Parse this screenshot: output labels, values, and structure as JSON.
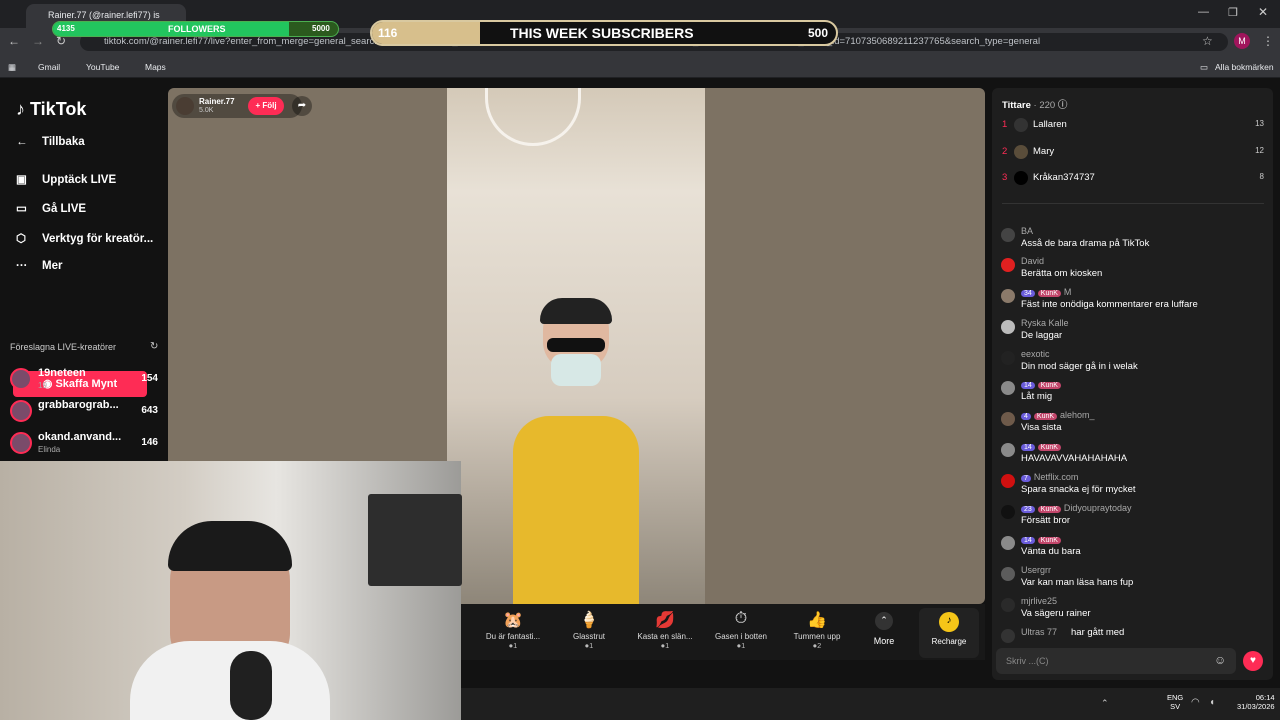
{
  "browser": {
    "tab_title": "Rainer.77 (@rainer.lefi77) is",
    "url": "tiktok.com/@rainer.lefi77/live?enter_from_merge=general_search&...photo&search_id=20260330210238 2D2DCFBE91F8D8E3001&search_keyword=rainer&search_result_id=7107350689211237765&search_type=general",
    "bookmarks": [
      "Gmail",
      "YouTube",
      "Maps"
    ],
    "all_bookmarks": "Alla bokmärken",
    "profile_initial": "M"
  },
  "overlay": {
    "followers_count": "4135",
    "followers_label": "FOLLOWERS",
    "followers_goal": "5000",
    "followers_progress": 0.827,
    "subs_count": "116",
    "subs_label": "THIS WEEK SUBSCRIBERS",
    "subs_goal": "500",
    "subs_progress": 0.232
  },
  "sidebar": {
    "logo": "TikTok",
    "back": "Tillbaka",
    "items": [
      "Upptäck LIVE",
      "Gå LIVE",
      "Verktyg för kreatör...",
      "Mer"
    ],
    "coins_button": "Skaffa Mynt",
    "suggested_title": "Föreslagna LIVE-kreatörer",
    "creators": [
      {
        "name": "19neteen",
        "sub": "19",
        "count": "154"
      },
      {
        "name": "grabbarograb...",
        "sub": "",
        "count": "643"
      },
      {
        "name": "okand.anvand...",
        "sub": "Elinda",
        "count": "146"
      }
    ]
  },
  "stream": {
    "host": "Rainer.77",
    "likes": "5.0K",
    "follow": "+ Följ"
  },
  "gifts": [
    {
      "name": "Du är fantasti...",
      "cost": "1"
    },
    {
      "name": "Glasstrut",
      "cost": "1"
    },
    {
      "name": "Kasta en slän...",
      "cost": "1"
    },
    {
      "name": "Gasen i botten",
      "cost": "1"
    },
    {
      "name": "Tummen upp",
      "cost": "2"
    }
  ],
  "gift_more": "More",
  "recharge": "Recharge",
  "viewers": {
    "title": "Tittare",
    "count": "220",
    "list": [
      {
        "rank": "1",
        "name": "Lallaren",
        "score": "13"
      },
      {
        "rank": "2",
        "name": "Mary",
        "score": "12"
      },
      {
        "rank": "3",
        "name": "Kråkan374737",
        "score": "8"
      }
    ]
  },
  "chat": [
    {
      "user": "BA",
      "text": "Asså de bara drama på TikTok",
      "level": "",
      "fan": ""
    },
    {
      "user": "David",
      "text": "Berätta om kiosken",
      "level": "",
      "fan": ""
    },
    {
      "user": "M",
      "text": "Fäst inte onödiga kommentarer era luffare",
      "level": "34",
      "fan": "KunK"
    },
    {
      "user": "Ryska Kalle",
      "text": "De laggar",
      "level": "",
      "fan": ""
    },
    {
      "user": "eexotic",
      "text": "Din mod säger gå in i welak",
      "level": "",
      "fan": ""
    },
    {
      "user": "",
      "text": "Låt mig",
      "level": "14",
      "fan": "KunK"
    },
    {
      "user": "alehom_",
      "text": "Visa sista",
      "level": "4",
      "fan": "KunK"
    },
    {
      "user": "",
      "text": "HAVAVAVVAHAHAHAHA",
      "level": "14",
      "fan": "KunK"
    },
    {
      "user": "Netflix.com",
      "text": "Spara snacka ej för mycket",
      "level": "7",
      "fan": ""
    },
    {
      "user": "Didyoupraytoday",
      "text": "Försätt bror",
      "level": "23",
      "fan": "KunK"
    },
    {
      "user": "",
      "text": "Vänta du bara",
      "level": "14",
      "fan": "KunK"
    },
    {
      "user": "Usergrr",
      "text": "Var kan man läsa hans fup",
      "level": "",
      "fan": ""
    },
    {
      "user": "mjrlive25",
      "text": "Va sägeru rainer",
      "level": "",
      "fan": ""
    },
    {
      "user": "Ultras 77",
      "text": "har gått med",
      "level": "",
      "fan": ""
    }
  ],
  "chat_placeholder": "Skriv ...(C)",
  "taskbar": {
    "lang": "ENG",
    "lang2": "SV",
    "time": "06:14",
    "date": "31/03/2026"
  }
}
